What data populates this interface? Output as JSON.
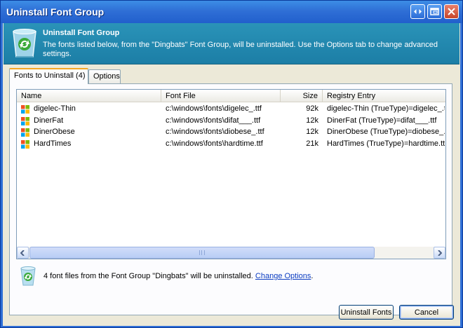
{
  "window": {
    "title": "Uninstall Font Group"
  },
  "header": {
    "title": "Uninstall Font Group",
    "description": "The fonts listed below, from the \"Dingbats\" Font Group, will be uninstalled. Use the Options tab to change advanced settings."
  },
  "tabs": [
    {
      "label": "Fonts to Uninstall (4)",
      "active": true
    },
    {
      "label": "Options",
      "active": false
    }
  ],
  "list": {
    "columns": [
      "Name",
      "Font File",
      "Size",
      "Registry Entry"
    ],
    "rows": [
      {
        "name": "digelec-Thin",
        "file": "c:\\windows\\fonts\\digelec_.ttf",
        "size": "92k",
        "registry": "digelec-Thin (TrueType)=digelec_.ttf"
      },
      {
        "name": "DinerFat",
        "file": "c:\\windows\\fonts\\difat___.ttf",
        "size": "12k",
        "registry": "DinerFat (TrueType)=difat___.ttf"
      },
      {
        "name": "DinerObese",
        "file": "c:\\windows\\fonts\\diobese_.ttf",
        "size": "12k",
        "registry": "DinerObese (TrueType)=diobese_.ttf"
      },
      {
        "name": "HardTimes",
        "file": "c:\\windows\\fonts\\hardtime.ttf",
        "size": "21k",
        "registry": "HardTimes (TrueType)=hardtime.ttf"
      }
    ]
  },
  "status": {
    "text": "4 font files from the Font Group \"Dingbats\" will be uninstalled. ",
    "link": "Change Options",
    "suffix": "."
  },
  "buttons": {
    "uninstall": "Uninstall Fonts",
    "cancel": "Cancel"
  },
  "colors": {
    "title_bar": "#2f6fd6",
    "header_band": "#2a93b8",
    "client_bg": "#ece9d8",
    "link": "#0b3cc1"
  },
  "icons": [
    "recycle-bin-icon",
    "font-file-icon",
    "scroll-left-icon",
    "scroll-right-icon",
    "restore-icon",
    "maximize-icon",
    "close-icon"
  ]
}
